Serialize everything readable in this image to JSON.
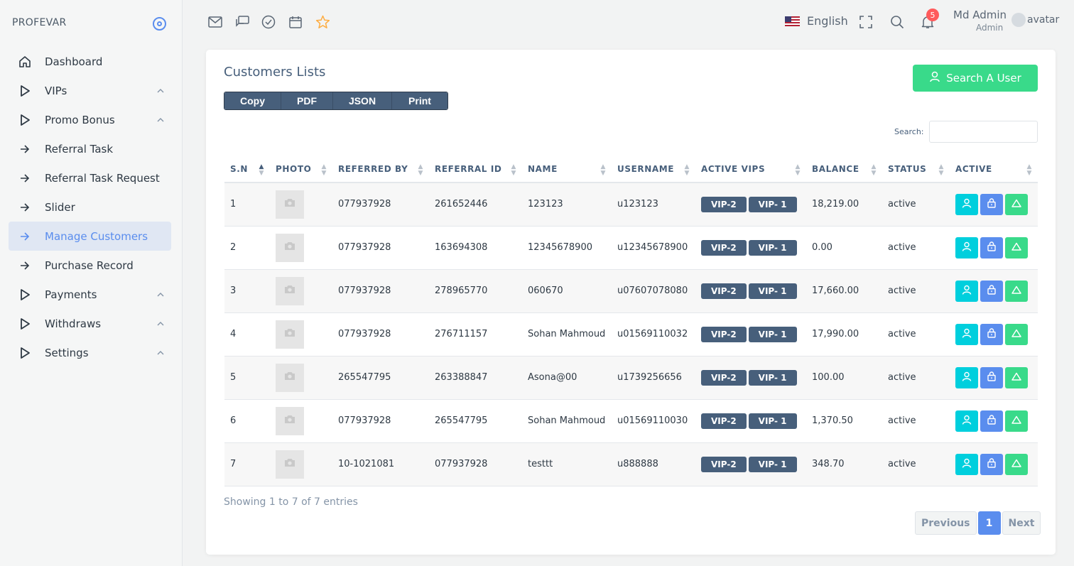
{
  "brand": {
    "name": "PROFEVAR"
  },
  "sidebar": {
    "items": [
      {
        "label": "Dashboard",
        "icon": "home-icon",
        "chevron": false,
        "active": false
      },
      {
        "label": "VIPs",
        "icon": "play-icon",
        "chevron": true,
        "active": false
      },
      {
        "label": "Promo Bonus",
        "icon": "play-icon",
        "chevron": true,
        "active": false
      },
      {
        "label": "Referral Task",
        "icon": "arrow-right-icon",
        "chevron": false,
        "active": false
      },
      {
        "label": "Referral Task Request",
        "icon": "arrow-right-icon",
        "chevron": false,
        "active": false
      },
      {
        "label": "Slider",
        "icon": "arrow-right-icon",
        "chevron": false,
        "active": false
      },
      {
        "label": "Manage Customers",
        "icon": "arrow-right-icon",
        "chevron": false,
        "active": true
      },
      {
        "label": "Purchase Record",
        "icon": "arrow-right-icon",
        "chevron": false,
        "active": false
      },
      {
        "label": "Payments",
        "icon": "play-icon",
        "chevron": true,
        "active": false
      },
      {
        "label": "Withdraws",
        "icon": "play-icon",
        "chevron": true,
        "active": false
      },
      {
        "label": "Settings",
        "icon": "play-icon",
        "chevron": true,
        "active": false
      }
    ]
  },
  "topbar": {
    "icons": [
      "mail-icon",
      "chat-icon",
      "check-circle-icon",
      "calendar-icon",
      "star-icon"
    ],
    "language": "English",
    "notification_count": "5",
    "user_name": "Md Admin",
    "user_role": "Admin",
    "avatar_alt": "avatar"
  },
  "card": {
    "title": "Customers Lists",
    "search_user_label": "Search A User",
    "export_buttons": [
      "Copy",
      "PDF",
      "JSON",
      "Print"
    ],
    "search_label": "Search:",
    "search_value": ""
  },
  "table": {
    "columns": [
      "S.N",
      "PHOTO",
      "REFERRED BY",
      "REFERRAL ID",
      "NAME",
      "USERNAME",
      "ACTIVE VIPS",
      "BALANCE",
      "STATUS",
      "ACTIVE"
    ],
    "rows": [
      {
        "sn": "1",
        "referred_by": "077937928",
        "referral_id": "261652446",
        "name": "123123",
        "username": "u123123",
        "vips": [
          "VIP-2",
          "VIP- 1"
        ],
        "balance": "18,219.00",
        "status": "active"
      },
      {
        "sn": "2",
        "referred_by": "077937928",
        "referral_id": "163694308",
        "name": "12345678900",
        "username": "u12345678900",
        "vips": [
          "VIP-2",
          "VIP- 1"
        ],
        "balance": "0.00",
        "status": "active"
      },
      {
        "sn": "3",
        "referred_by": "077937928",
        "referral_id": "278965770",
        "name": "060670",
        "username": "u07607078080",
        "vips": [
          "VIP-2",
          "VIP- 1"
        ],
        "balance": "17,660.00",
        "status": "active"
      },
      {
        "sn": "4",
        "referred_by": "077937928",
        "referral_id": "276711157",
        "name": "Sohan Mahmoud",
        "username": "u01569110032",
        "vips": [
          "VIP-2",
          "VIP- 1"
        ],
        "balance": "17,990.00",
        "status": "active"
      },
      {
        "sn": "5",
        "referred_by": "265547795",
        "referral_id": "263388847",
        "name": "Asona@00",
        "username": "u1739256656",
        "vips": [
          "VIP-2",
          "VIP- 1"
        ],
        "balance": "100.00",
        "status": "active"
      },
      {
        "sn": "6",
        "referred_by": "077937928",
        "referral_id": "265547795",
        "name": "Sohan Mahmoud",
        "username": "u01569110030",
        "vips": [
          "VIP-2",
          "VIP- 1"
        ],
        "balance": "1,370.50",
        "status": "active"
      },
      {
        "sn": "7",
        "referred_by": "10-1021081",
        "referral_id": "077937928",
        "name": "testtt",
        "username": "u888888",
        "vips": [
          "VIP-2",
          "VIP- 1"
        ],
        "balance": "348.70",
        "status": "active"
      }
    ]
  },
  "footer": {
    "info": "Showing 1 to 7 of 7 entries",
    "previous": "Previous",
    "current_page": "1",
    "next": "Next"
  },
  "colors": {
    "accent": "#5a8dee",
    "success": "#39da8a",
    "info": "#00cfdd",
    "badge": "#475f7b"
  }
}
